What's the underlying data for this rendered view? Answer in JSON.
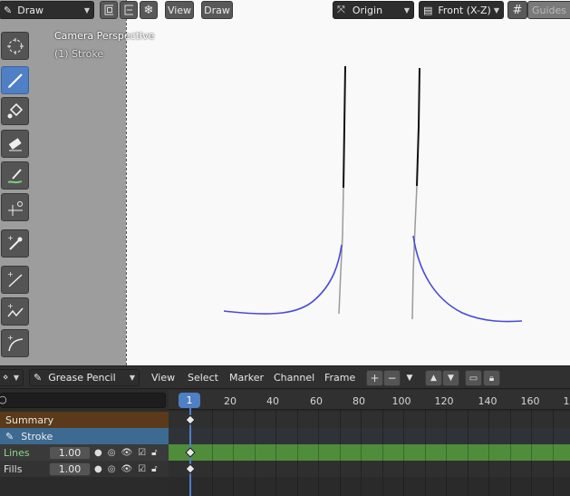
{
  "viewport": {
    "mode_label": "Draw",
    "view_menu": "View",
    "draw_menu": "Draw",
    "origin_label": "Origin",
    "front_label": "Front (X-Z)",
    "guides_label": "Guides",
    "overlay_camera": "Camera Perspective",
    "overlay_stroke": "(1) Stroke",
    "stroke_color": "#4a4ad8"
  },
  "toolbar": {
    "tools": [
      "cursor-icon",
      "draw-icon",
      "fill-icon",
      "erase-icon",
      "tint-icon",
      "cutter-icon",
      "eyedropper-icon",
      "line-icon",
      "polyline-icon",
      "arc-icon"
    ],
    "active": "draw-icon",
    "accent": "#4f7fc4"
  },
  "dopesheet": {
    "mode_label": "Grease Pencil",
    "menus": [
      "View",
      "Select",
      "Marker",
      "Channel",
      "Frame"
    ],
    "current_frame": "1",
    "ruler_ticks": [
      "20",
      "40",
      "60",
      "80",
      "100",
      "120",
      "140",
      "160",
      "1"
    ],
    "channels": {
      "summary": "Summary",
      "stroke": "Stroke",
      "lines": {
        "name": "Lines",
        "opacity": "1.00"
      },
      "fills": {
        "name": "Fills",
        "opacity": "1.00"
      }
    },
    "lines_track_color": "#4f8d3a"
  }
}
